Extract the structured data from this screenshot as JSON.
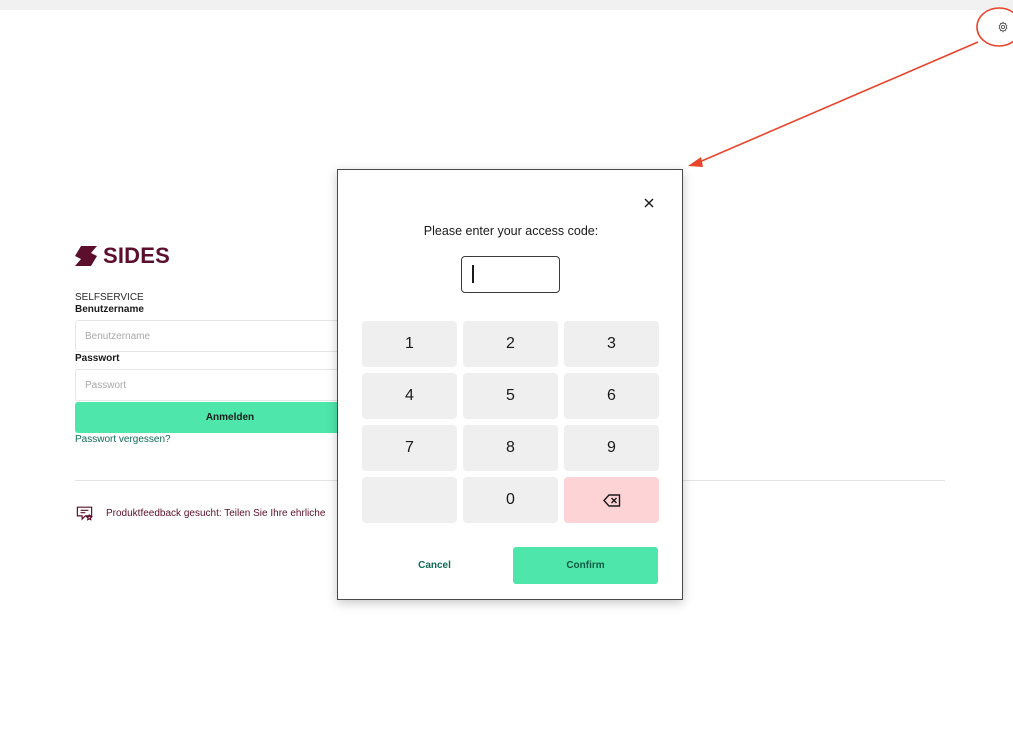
{
  "login": {
    "brand": "SIDES",
    "section_label": "SELFSERVICE",
    "username_label": "Benutzername",
    "username_placeholder": "Benutzername",
    "password_label": "Passwort",
    "password_placeholder": "Passwort",
    "login_button": "Anmelden",
    "forgot_password": "Passwort vergessen?",
    "feedback_text": "Produktfeedback gesucht: Teilen Sie Ihre ehrliche"
  },
  "modal": {
    "title": "Please enter your access code:",
    "code_value": "",
    "keys": [
      "1",
      "2",
      "3",
      "4",
      "5",
      "6",
      "7",
      "8",
      "9",
      "",
      "0",
      "backspace-icon"
    ],
    "cancel_label": "Cancel",
    "confirm_label": "Confirm"
  },
  "colors": {
    "brand": "#5c0f2c",
    "accent": "#4ee6aa",
    "link": "#0f6b55",
    "backspace_key": "#fdd3d6",
    "key": "#efefef",
    "annotation": "#e8452b"
  },
  "icons": {
    "settings": "gear-icon",
    "close": "close-icon",
    "backspace": "backspace-icon",
    "feedback": "feedback-star-icon",
    "logo": "sides-logo-icon"
  }
}
